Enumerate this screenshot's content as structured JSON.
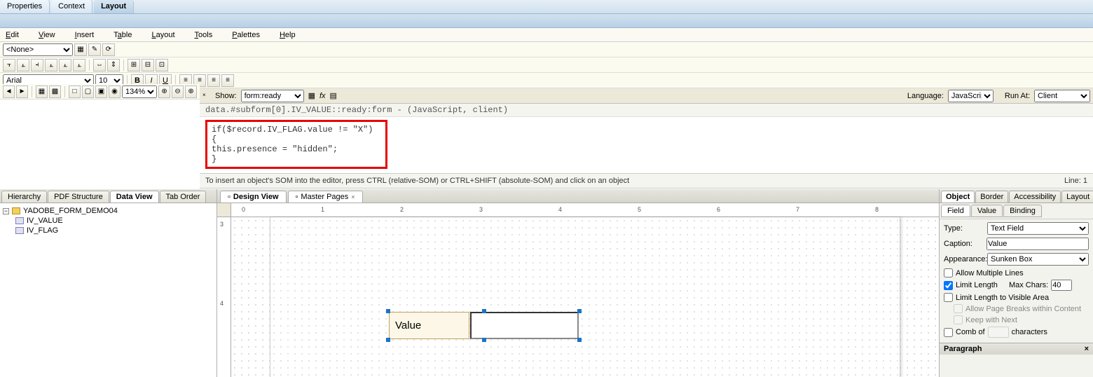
{
  "top_tabs": [
    "Properties",
    "Context",
    "Layout"
  ],
  "top_tabs_active": 2,
  "menu": [
    "Edit",
    "View",
    "Insert",
    "Table",
    "Layout",
    "Tools",
    "Palettes",
    "Help"
  ],
  "style_select": "<None>",
  "font_name": "Arial",
  "font_size": "10",
  "zoom": "134%",
  "script": {
    "show_label": "Show:",
    "show_value": "form:ready",
    "language_label": "Language:",
    "language_value": "JavaScript",
    "run_at_label": "Run At:",
    "run_at_value": "Client",
    "header_line": "data.#subform[0].IV_VALUE::ready:form - (JavaScript, client)",
    "code": "if($record.IV_FLAG.value != \"X\")\n{\nthis.presence = \"hidden\";\n}",
    "status": "To insert an object's SOM into the editor, press CTRL (relative-SOM) or CTRL+SHIFT (absolute-SOM) and click on an object",
    "line_label": "Line: 1"
  },
  "left_tabs": [
    "Hierarchy",
    "PDF Structure",
    "Data View",
    "Tab Order"
  ],
  "left_tabs_active": 2,
  "tree": {
    "root": "YADOBE_FORM_DEMO04",
    "children": [
      "IV_VALUE",
      "IV_FLAG"
    ]
  },
  "center_tabs": [
    "Design View",
    "Master Pages"
  ],
  "center_tabs_active": 0,
  "ruler_h": [
    "0",
    "1",
    "2",
    "3",
    "4",
    "5",
    "6",
    "7",
    "8"
  ],
  "ruler_v": [
    "3",
    "4"
  ],
  "field_caption": "Value",
  "right": {
    "tabs": [
      "Object",
      "Border",
      "Accessibility",
      "Layout"
    ],
    "tabs_active": 0,
    "subtabs": [
      "Field",
      "Value",
      "Binding"
    ],
    "subtabs_active": 0,
    "type_label": "Type:",
    "type_value": "Text Field",
    "caption_label": "Caption:",
    "caption_value": "Value",
    "appearance_label": "Appearance:",
    "appearance_value": "Sunken Box",
    "allow_multiple": "Allow Multiple Lines",
    "limit_length": "Limit Length",
    "max_chars_label": "Max Chars:",
    "max_chars_value": "40",
    "limit_visible": "Limit Length to Visible Area",
    "allow_page_breaks": "Allow Page Breaks within Content",
    "keep_with_next": "Keep with Next",
    "comb_of": "Comb of",
    "characters": "characters",
    "paragraph": "Paragraph"
  }
}
